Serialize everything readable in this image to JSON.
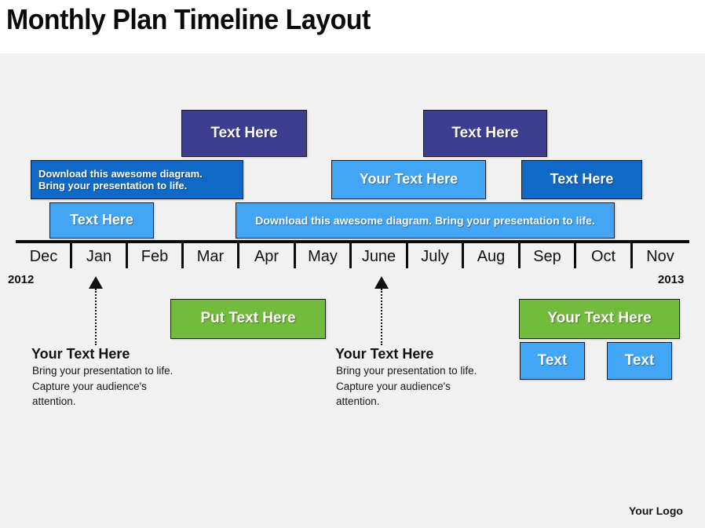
{
  "header": {
    "title": "Monthly Plan Timeline Layout"
  },
  "timeline": {
    "start_year": "2012",
    "end_year": "2013",
    "months": [
      "Dec",
      "Jan",
      "Feb",
      "Mar",
      "Apr",
      "May",
      "June",
      "July",
      "Aug",
      "Sep",
      "Oct",
      "Nov"
    ]
  },
  "above_bars": [
    {
      "label": "Text Here",
      "color": "#3e3e91"
    },
    {
      "label": "Download this awesome diagram.\nBring your presentation to life.",
      "color": "#1069c6"
    },
    {
      "label": "Text Here",
      "color": "#42a5f5"
    },
    {
      "label": "Text Here",
      "color": "#3e3e91"
    },
    {
      "label": "Your Text Here",
      "color": "#42a5f5"
    },
    {
      "label": "Text Here",
      "color": "#1069c6"
    },
    {
      "label": "Download this awesome diagram. Bring your presentation to life.",
      "color": "#42a5f5"
    }
  ],
  "below_bars": [
    {
      "label": "Put Text Here",
      "color": "#72bb3c"
    },
    {
      "label": "Your Text Here",
      "color": "#72bb3c"
    },
    {
      "label": "Text",
      "color": "#42a5f5"
    },
    {
      "label": "Text",
      "color": "#42a5f5"
    }
  ],
  "callouts": [
    {
      "title": "Your Text Here",
      "body": "Bring your presentation to life.\nCapture your audience's\nattention.",
      "anchor_month": "Jan"
    },
    {
      "title": "Your Text Here",
      "body": "Bring your presentation to life.\nCapture your audience's\nattention.",
      "anchor_month": "June"
    }
  ],
  "footer": {
    "logo": "Your Logo"
  },
  "colors": {
    "navy": "#3e3e91",
    "medium_blue": "#1069c6",
    "light_blue": "#42a5f5",
    "green": "#72bb3c",
    "background": "#f1f1f1",
    "axis": "#0b0b0b"
  }
}
